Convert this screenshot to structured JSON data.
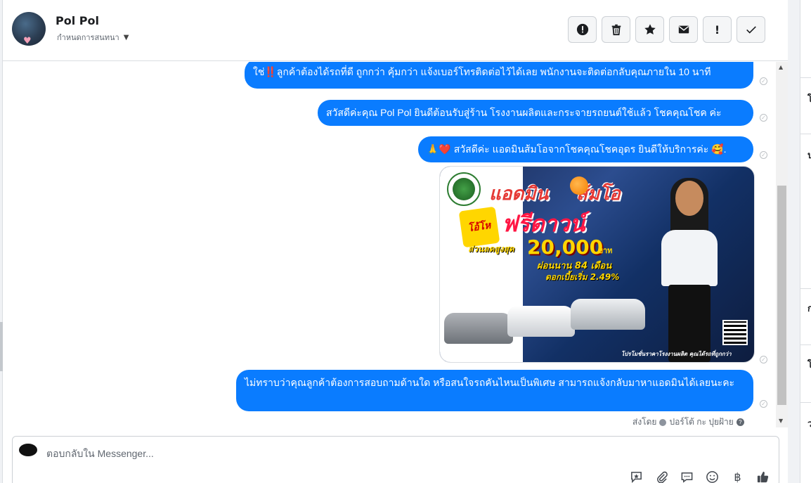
{
  "header": {
    "name": "Pol Pol",
    "subtitle": "กำหนดการสนทนา",
    "actions": [
      "report-icon",
      "trash-icon",
      "star-icon",
      "envelope-icon",
      "exclamation-icon",
      "check-icon"
    ]
  },
  "messages": [
    {
      "text": "ใช่‼️ลูกค้าต้องได้รถที่ดี ถูกกว่า คุ้มกว่า แจ้งเบอร์โทรติดต่อไว้ได้เลย พนักงานจะติดต่อกลับคุณภายใน 10 นาที"
    },
    {
      "text": "สวัสดีค่ะคุณ Pol Pol ยินดีต้อนรับสู่ร้าน โรงงานผลิตและกระจายรถยนต์ใช้แล้ว โชคคุณโชค ค่ะ"
    },
    {
      "text": "🙏❤️ สวัสดีค่ะ แอดมินส้มโอจากโชคคุณโชคอุดร ยินดีให้บริการค่ะ 🥰."
    },
    {
      "text": "ไม่ทราบว่าคุณลูกค้าต้องการสอบถามด้านใด หรือสนใจรถคันไหนเป็นพิเศษ สามารถแจ้งกลับมาหาแอดมินได้เลยนะคะ"
    }
  ],
  "promo": {
    "title": "แอดมิน",
    "title2": "ส้มโอ",
    "badge": "โอ้โห",
    "free": "ฟรีดาวน์",
    "discount_label": "ส่วนลดสูงสุด",
    "discount_value": "20,000",
    "discount_unit": "บาท",
    "term": "ผ่อนนาน 84 เดือน",
    "rate": "ดอกเบี้ยเริ่ม 2.49%",
    "footer": "โปรโมชั่นราคาโรงงานผลิต คุณได้รถที่ถูกกว่า"
  },
  "sent_by": {
    "label": "ส่งโดย",
    "name": "ปอร์โต้ กะ ปุยฝ้าย"
  },
  "composer": {
    "placeholder": "ตอบกลับใน Messenger...",
    "icons": [
      "saved-reply-icon",
      "attachment-icon",
      "chat-bubble-icon",
      "emoji-icon",
      "baht-icon",
      "like-icon"
    ]
  },
  "right_pane": {
    "fragments": [
      "โ",
      "ป",
      "ก",
      "โ",
      "ว"
    ]
  }
}
